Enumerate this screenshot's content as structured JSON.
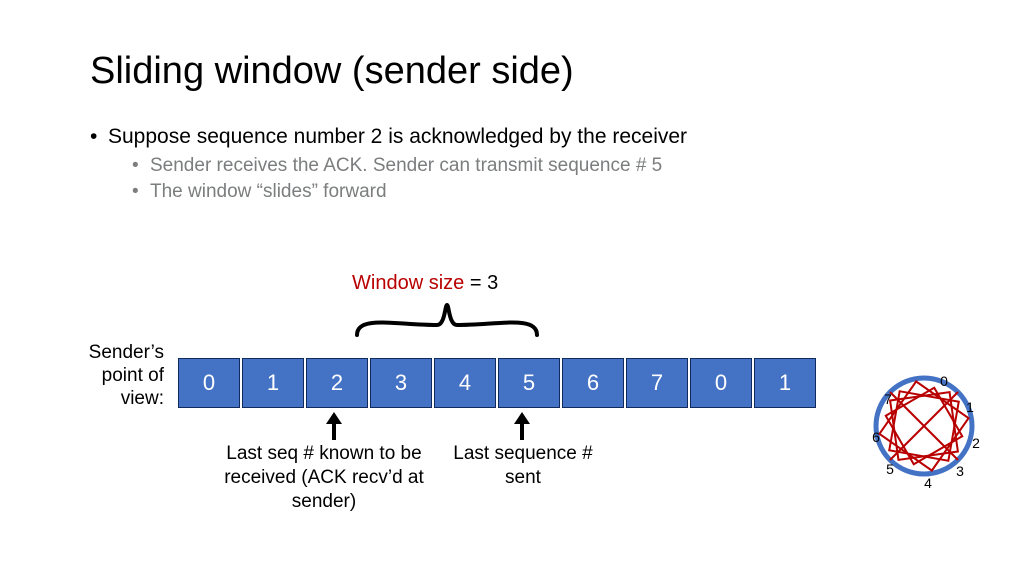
{
  "title": "Sliding window (sender side)",
  "bullets": {
    "b1": "Suppose sequence number 2 is acknowledged by the receiver",
    "b2a": "Sender receives the ACK. Sender can transmit sequence # 5",
    "b2b": "The window “slides” forward"
  },
  "window_size": {
    "label": "Window size",
    "sep": " = ",
    "value": "3"
  },
  "sender_label": "Sender’s point of view:",
  "cells": [
    "0",
    "1",
    "2",
    "3",
    "4",
    "5",
    "6",
    "7",
    "0",
    "1"
  ],
  "annotations": {
    "ack": "Last seq # known to be received (ACK recv’d at sender)",
    "sent": "Last sequence # sent"
  },
  "dial_labels": [
    "0",
    "1",
    "2",
    "3",
    "4",
    "5",
    "6",
    "7"
  ],
  "colors": {
    "cell_bg": "#4472c4",
    "accent_red": "#b90000"
  }
}
